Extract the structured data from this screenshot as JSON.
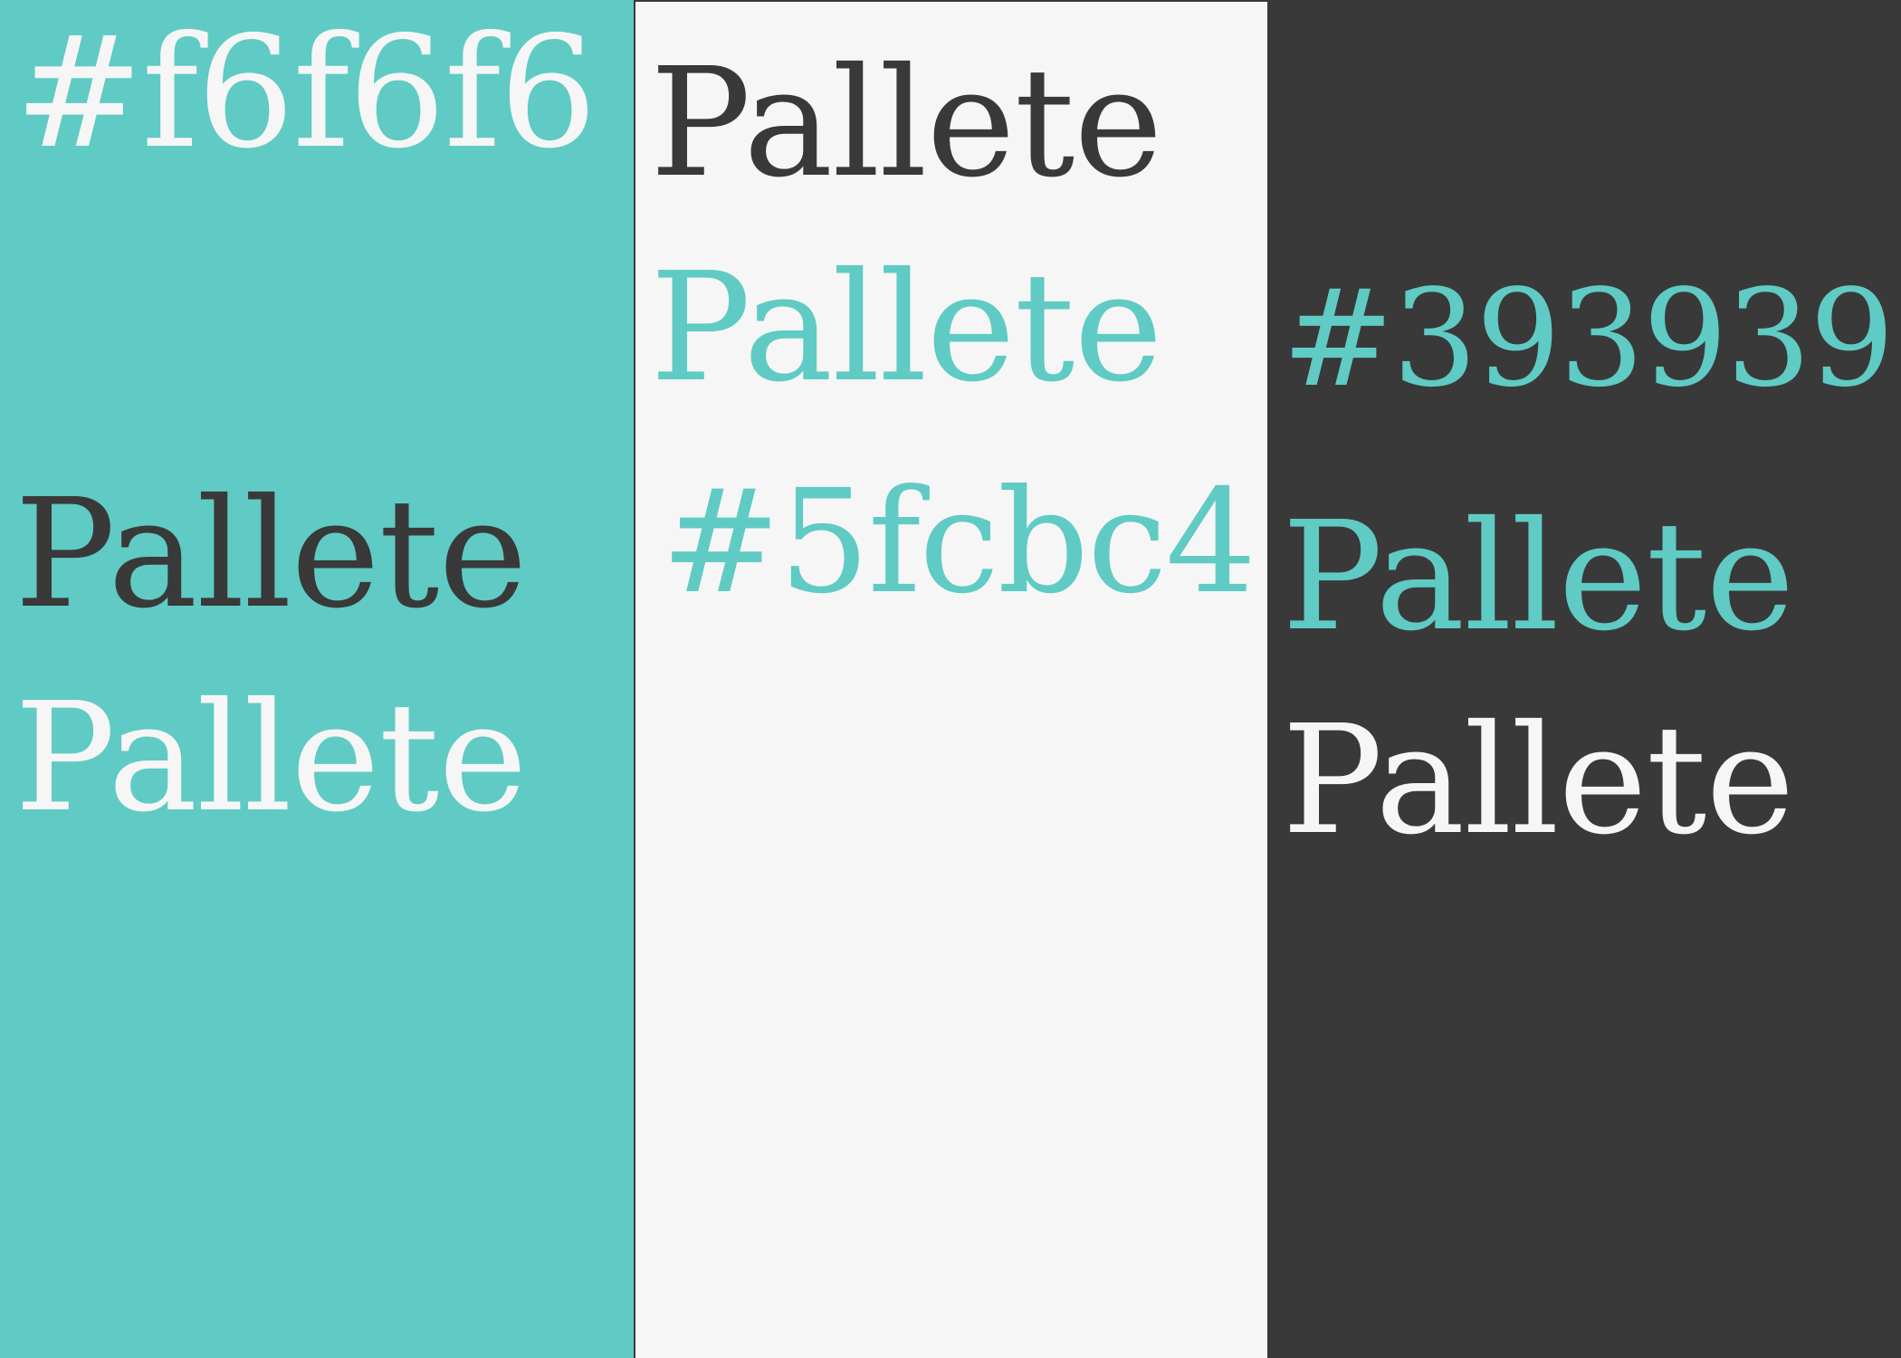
{
  "colors": {
    "teal": "#5fcbc4",
    "light": "#f6f6f6",
    "dark": "#393939"
  },
  "swatches": [
    {
      "background": "#5fcbc4",
      "hex_label": "#f6f6f6",
      "hex_label_color": "#f6f6f6",
      "samples": [
        {
          "text": "Pallete",
          "color": "#393939"
        },
        {
          "text": "Pallete",
          "color": "#f6f6f6"
        }
      ]
    },
    {
      "background": "#f6f6f6",
      "hex_label": "#5fcbc4",
      "hex_label_color": "#5fcbc4",
      "samples": [
        {
          "text": "Pallete",
          "color": "#393939"
        },
        {
          "text": "Pallete",
          "color": "#5fcbc4"
        }
      ]
    },
    {
      "background": "#393939",
      "hex_label": "#393939",
      "hex_label_color": "#5fcbc4",
      "samples": [
        {
          "text": "Pallete",
          "color": "#5fcbc4"
        },
        {
          "text": "Pallete",
          "color": "#f6f6f6"
        }
      ]
    }
  ]
}
